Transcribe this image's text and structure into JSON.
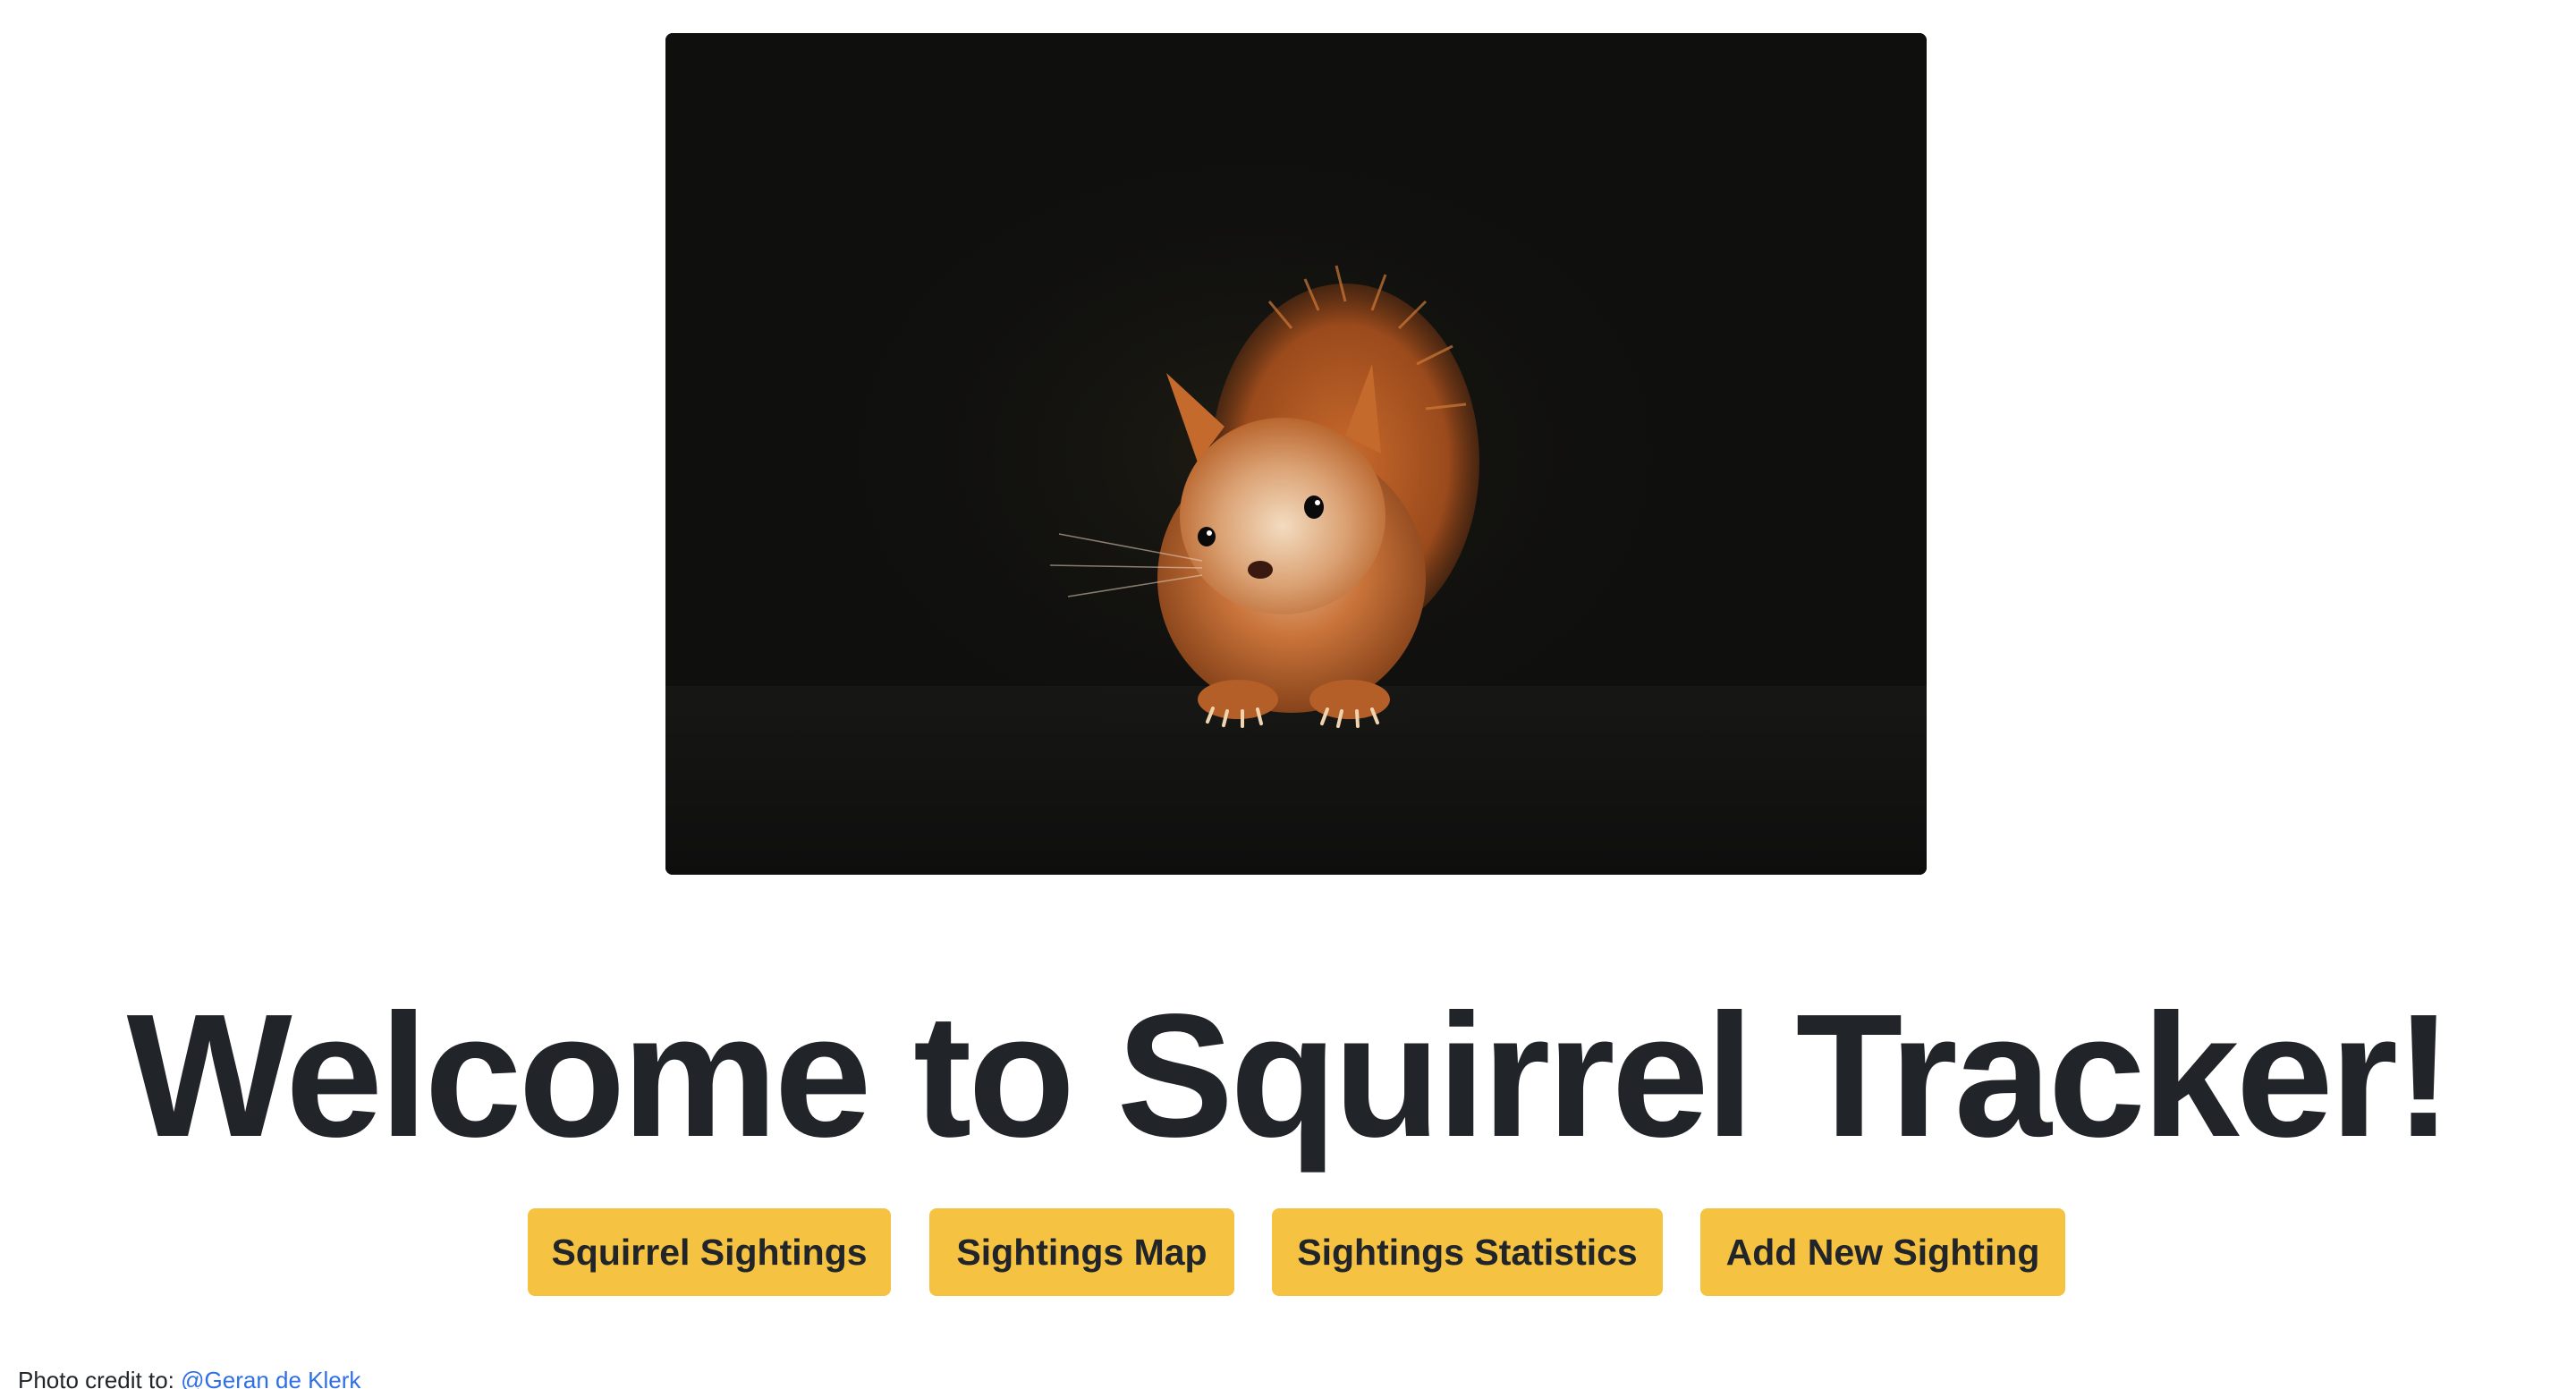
{
  "hero": {
    "image_subject": "red squirrel on dark background"
  },
  "title": "Welcome to Squirrel Tracker!",
  "buttons": [
    {
      "label": "Squirrel Sightings"
    },
    {
      "label": "Sightings Map"
    },
    {
      "label": "Sightings Statistics"
    },
    {
      "label": "Add New Sighting"
    }
  ],
  "credit": {
    "prefix": "Photo credit to:",
    "link_text": "@Geran de Klerk"
  },
  "colors": {
    "button_bg": "#f5c242",
    "text": "#212529",
    "link": "#2f6fe4",
    "hero_bg": "#0f0f0e"
  }
}
